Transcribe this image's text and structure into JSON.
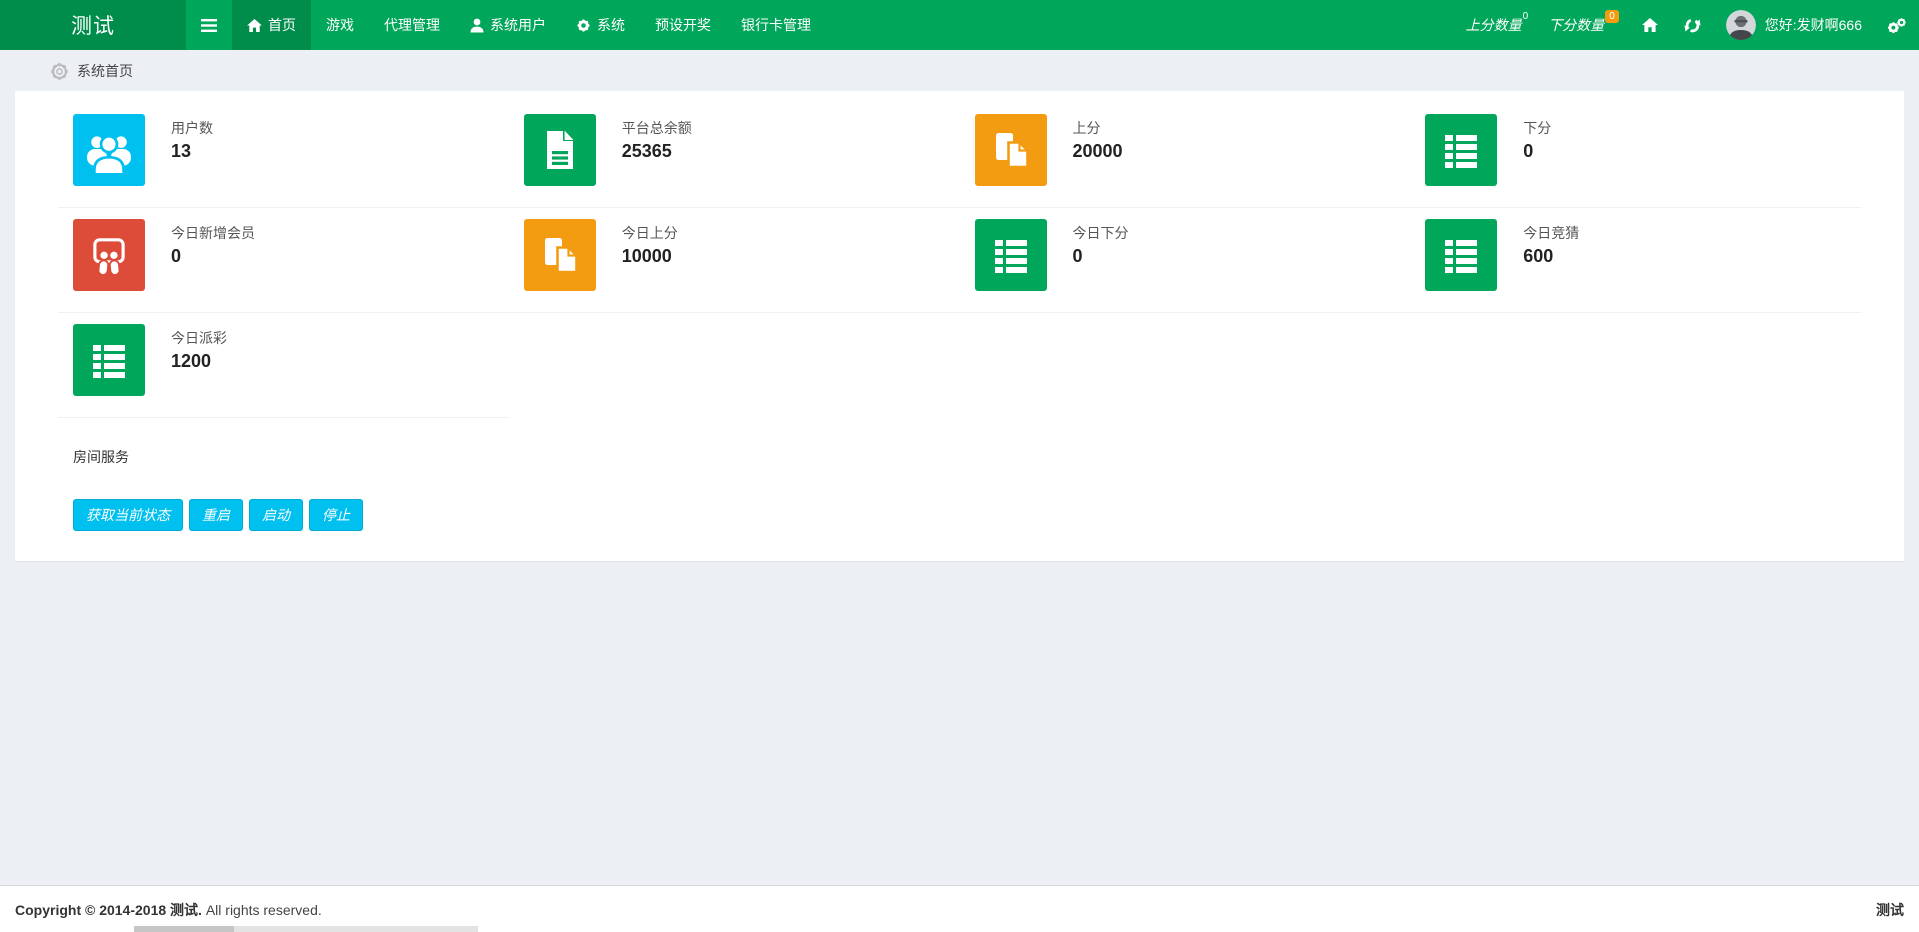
{
  "navbar": {
    "brand": "测试",
    "menu": [
      {
        "label": "首页",
        "icon": "home-icon",
        "active": true
      },
      {
        "label": "游戏"
      },
      {
        "label": "代理管理"
      },
      {
        "label": "系统用户",
        "icon": "user-icon"
      },
      {
        "label": "系统",
        "icon": "gear-icon"
      },
      {
        "label": "预设开奖"
      },
      {
        "label": "银行卡管理"
      }
    ],
    "right": {
      "up_label": "上分数量",
      "up_badge": "0",
      "down_label": "下分数量",
      "down_badge": "0",
      "greeting": "您好:发财啊666"
    }
  },
  "breadcrumb": {
    "label": "系统首页"
  },
  "stats": [
    {
      "label": "用户数",
      "value": "13",
      "icon": "users-icon",
      "color": "#00c0ef"
    },
    {
      "label": "平台总余额",
      "value": "25365",
      "icon": "file-text-icon",
      "color": "#00a65a"
    },
    {
      "label": "上分",
      "value": "20000",
      "icon": "copy-icon",
      "color": "#f39c12"
    },
    {
      "label": "下分",
      "value": "0",
      "icon": "list-icon",
      "color": "#00a65a"
    },
    {
      "label": "今日新增会员",
      "value": "0",
      "icon": "slideshare-icon",
      "color": "#dd4b39"
    },
    {
      "label": "今日上分",
      "value": "10000",
      "icon": "copy-icon",
      "color": "#f39c12"
    },
    {
      "label": "今日下分",
      "value": "0",
      "icon": "list-icon",
      "color": "#00a65a"
    },
    {
      "label": "今日竞猜",
      "value": "600",
      "icon": "list-icon",
      "color": "#00a65a"
    },
    {
      "label": "今日派彩",
      "value": "1200",
      "icon": "list-icon",
      "color": "#00a65a"
    }
  ],
  "room_service": {
    "title": "房间服务",
    "buttons": {
      "status": "获取当前状态",
      "restart": "重启",
      "start": "启动",
      "stop": "停止"
    }
  },
  "footer": {
    "copyright_bold": "Copyright © 2014-2018 测试.",
    "copyright_rest": " All rights reserved.",
    "right": "测试"
  },
  "colors": {
    "navbar": "#00a65a",
    "navbar_dark": "#008d4c",
    "aqua": "#00c0ef",
    "green": "#00a65a",
    "orange": "#f39c12",
    "red": "#dd4b39",
    "badge_warning": "#f39c12",
    "button": "#00c0ef"
  }
}
